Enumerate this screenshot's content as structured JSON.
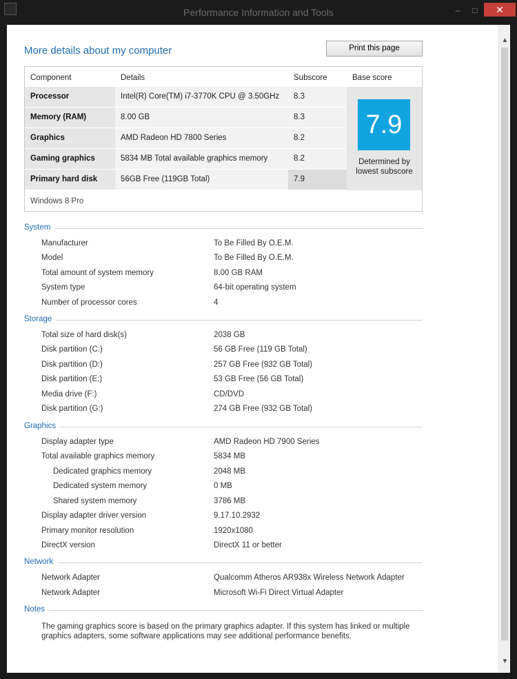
{
  "window": {
    "title": "Performance Information and Tools",
    "min": "–",
    "max": "□",
    "close": "✕"
  },
  "heading": "More details about my computer",
  "print_button": "Print this page",
  "score_table": {
    "headers": [
      "Component",
      "Details",
      "Subscore",
      "Base score"
    ],
    "rows": [
      {
        "component": "Processor",
        "details": "Intel(R) Core(TM) i7-3770K CPU @ 3.50GHz",
        "subscore": "8.3"
      },
      {
        "component": "Memory (RAM)",
        "details": "8.00 GB",
        "subscore": "8.3"
      },
      {
        "component": "Graphics",
        "details": "AMD Radeon HD 7800 Series",
        "subscore": "8.2"
      },
      {
        "component": "Gaming graphics",
        "details": "5834 MB Total available graphics memory",
        "subscore": "8.2"
      },
      {
        "component": "Primary hard disk",
        "details": "56GB Free (119GB Total)",
        "subscore": "7.9"
      }
    ],
    "base_score": "7.9",
    "base_note_1": "Determined by",
    "base_note_2": "lowest subscore",
    "os": "Windows 8 Pro",
    "score_color": "#11a4e0"
  },
  "sections": {
    "system": {
      "title": "System",
      "items": [
        {
          "k": "Manufacturer",
          "v": "To Be Filled By O.E.M."
        },
        {
          "k": "Model",
          "v": "To Be Filled By O.E.M."
        },
        {
          "k": "Total amount of system memory",
          "v": "8.00 GB RAM"
        },
        {
          "k": "System type",
          "v": "64-bit operating system"
        },
        {
          "k": "Number of processor cores",
          "v": "4"
        }
      ]
    },
    "storage": {
      "title": "Storage",
      "items": [
        {
          "k": "Total size of hard disk(s)",
          "v": "2038 GB"
        },
        {
          "k": "Disk partition (C:)",
          "v": "56 GB Free (119 GB Total)"
        },
        {
          "k": "Disk partition (D:)",
          "v": "257 GB Free (932 GB Total)"
        },
        {
          "k": "Disk partition (E:)",
          "v": "53 GB Free (56 GB Total)"
        },
        {
          "k": "Media drive (F:)",
          "v": "CD/DVD"
        },
        {
          "k": "Disk partition (G:)",
          "v": "274 GB Free (932 GB Total)"
        }
      ]
    },
    "graphics": {
      "title": "Graphics",
      "items": [
        {
          "k": "Display adapter type",
          "v": "AMD Radeon HD 7900 Series"
        },
        {
          "k": "Total available graphics memory",
          "v": "5834 MB"
        },
        {
          "k": "Dedicated graphics memory",
          "v": "2048 MB"
        },
        {
          "k": "Dedicated system memory",
          "v": "0 MB"
        },
        {
          "k": "Shared system memory",
          "v": "3786 MB"
        },
        {
          "k": "Display adapter driver version",
          "v": "9.17.10.2932"
        },
        {
          "k": "Primary monitor resolution",
          "v": "1920x1080"
        },
        {
          "k": "DirectX version",
          "v": "DirectX 11 or better"
        }
      ]
    },
    "network": {
      "title": "Network",
      "items": [
        {
          "k": "Network Adapter",
          "v": "Qualcomm Atheros AR938x Wireless Network Adapter"
        },
        {
          "k": "Network Adapter",
          "v": "Microsoft Wi-Fi Direct Virtual Adapter"
        }
      ]
    },
    "notes": {
      "title": "Notes",
      "text": "The gaming graphics score is based on the primary graphics adapter. If this system has linked or multiple graphics adapters, some software applications may see additional performance benefits."
    }
  }
}
